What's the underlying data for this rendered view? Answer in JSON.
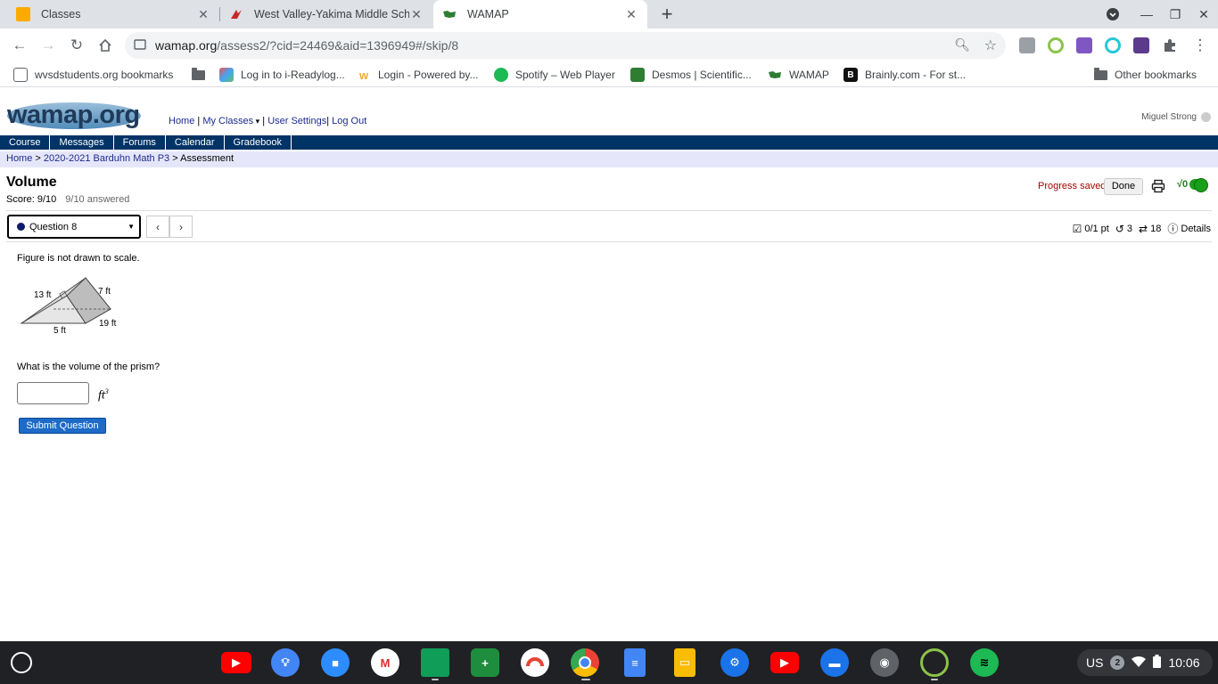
{
  "tabs": [
    {
      "title": "Classes",
      "favicon_color": "#f9ab00"
    },
    {
      "title": "West Valley-Yakima Middle School",
      "favicon_color": "#c62828"
    },
    {
      "title": "WAMAP",
      "favicon_color": "#2e7d32"
    }
  ],
  "omnibox": {
    "host": "wamap.org",
    "path": "/assess2/?cid=24469&aid=1396949#/skip/8"
  },
  "bookmarks": [
    {
      "label": "wvsdstudents.org bookmarks"
    },
    {
      "label": ""
    },
    {
      "label": "Log in to i-Readylog..."
    },
    {
      "label": "Login - Powered by..."
    },
    {
      "label": "Spotify – Web Player"
    },
    {
      "label": "Desmos | Scientific..."
    },
    {
      "label": "WAMAP"
    },
    {
      "label": "Brainly.com - For st..."
    },
    {
      "label": "Other bookmarks"
    }
  ],
  "site": {
    "logo_text": "wamap.org",
    "topnav": {
      "home": "Home",
      "sep1": " | ",
      "my_classes": "My Classes",
      "caret": " ▾",
      "sep2": " | ",
      "user_settings": "User Settings",
      "sep3": "| ",
      "log_out": "Log Out"
    },
    "user_name": "Miguel Strong"
  },
  "mainnav": [
    "Course",
    "Messages",
    "Forums",
    "Calendar",
    "Gradebook"
  ],
  "breadcrumb": {
    "home": "Home",
    "sep1": " > ",
    "course": "2020-2021 Barduhn Math P3",
    "sep2": " > ",
    "current": "Assessment"
  },
  "assessment": {
    "title": "Volume",
    "score": "Score: 9/10",
    "answered": "9/10 answered",
    "progress": "Progress saved",
    "done": "Done",
    "math_label": "√0"
  },
  "question_nav": {
    "selected": "Question 8",
    "points": "0/1 pt",
    "retries": "3",
    "attempts": "18",
    "details": "Details"
  },
  "question": {
    "note": "Figure is not drawn to scale.",
    "figure_labels": {
      "a": "13 ft",
      "b": "7 ft",
      "c": "5 ft",
      "d": "19 ft"
    },
    "prompt": "What is the volume of the prism?",
    "answer_value": "",
    "unit": "ft",
    "unit_exp": "3",
    "submit": "Submit Question"
  },
  "tray": {
    "lang": "US",
    "notifications": "2",
    "time": "10:06"
  }
}
